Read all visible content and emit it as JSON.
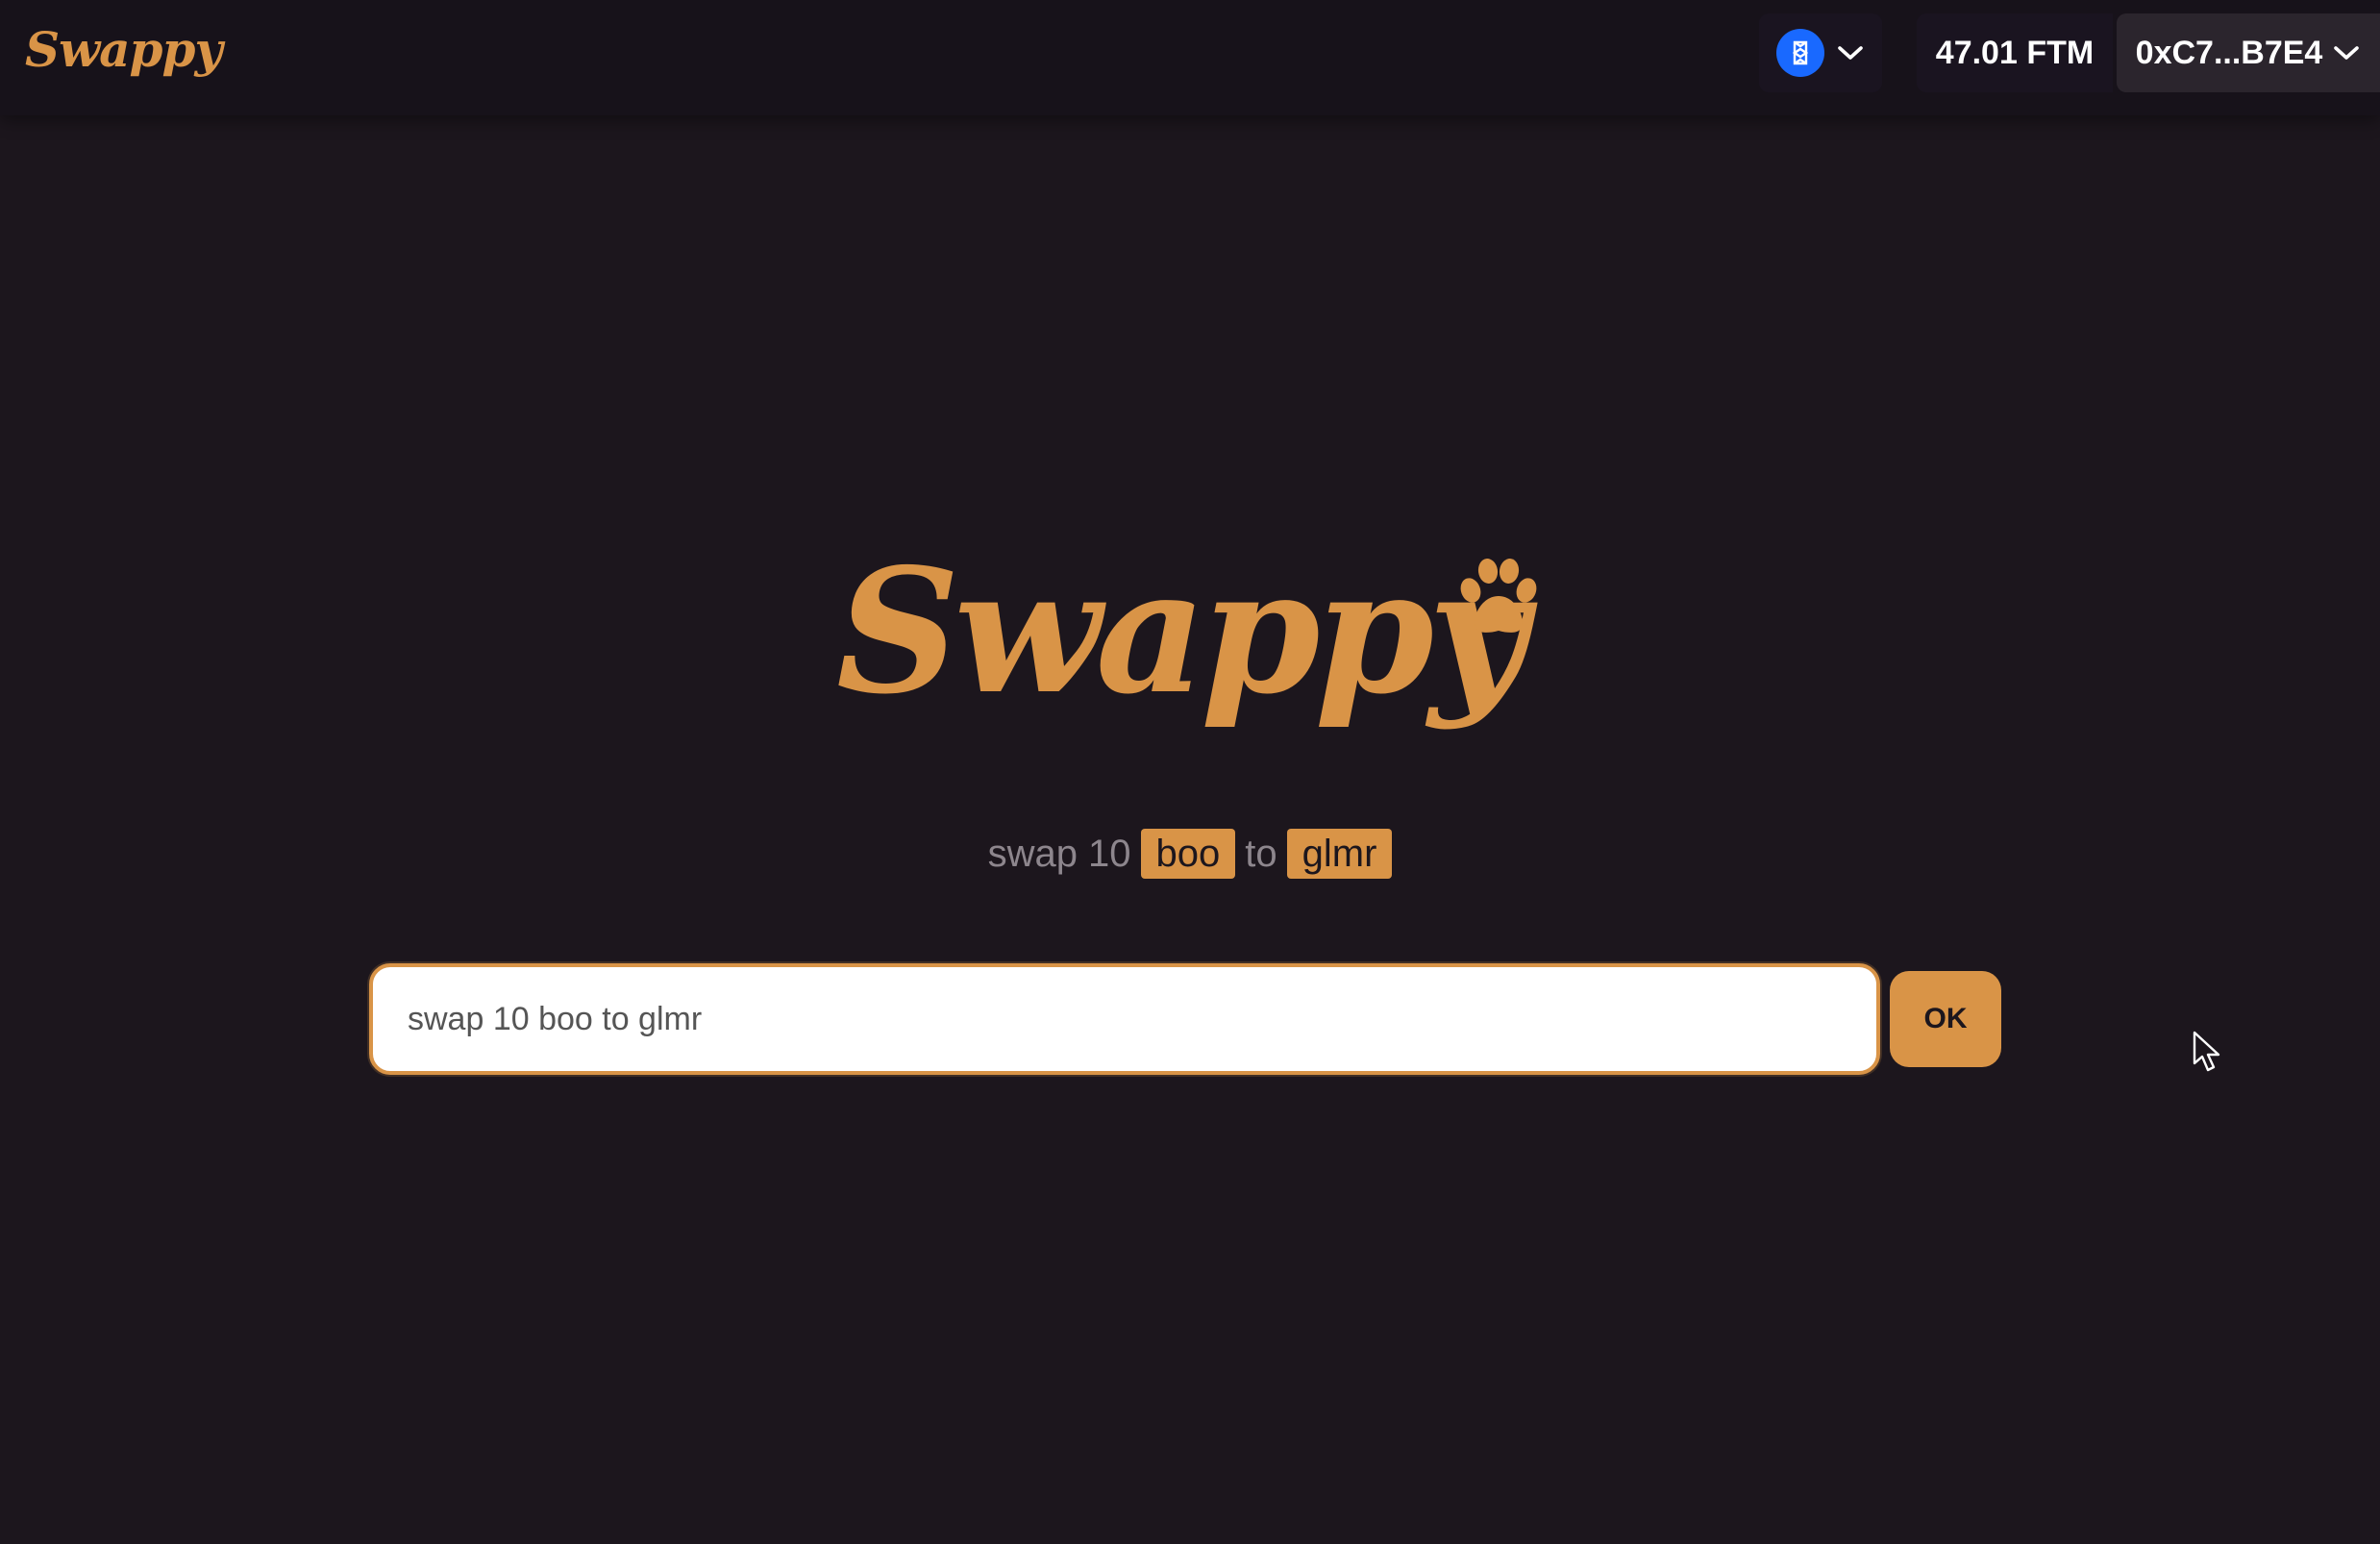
{
  "navbar": {
    "logo_text": "Swappy",
    "network": {
      "icon": "fantom-icon",
      "chevron": "chevron-down-icon"
    },
    "balance": "47.01 FTM",
    "account": "0xC7...B7E4"
  },
  "hero": {
    "logo_text": "Swappy",
    "logo_icon": "paw-icon",
    "example": {
      "prefix": "swap 10",
      "from_token": "boo",
      "connector": "to",
      "to_token": "glmr"
    }
  },
  "search": {
    "value": "",
    "placeholder": "swap 10 boo to glmr",
    "submit_label": "OK"
  },
  "colors": {
    "background": "#1c161d",
    "navbar": "#17121a",
    "accent": "#d99447",
    "network_blue": "#1969ff",
    "muted_text": "#8d868d"
  }
}
